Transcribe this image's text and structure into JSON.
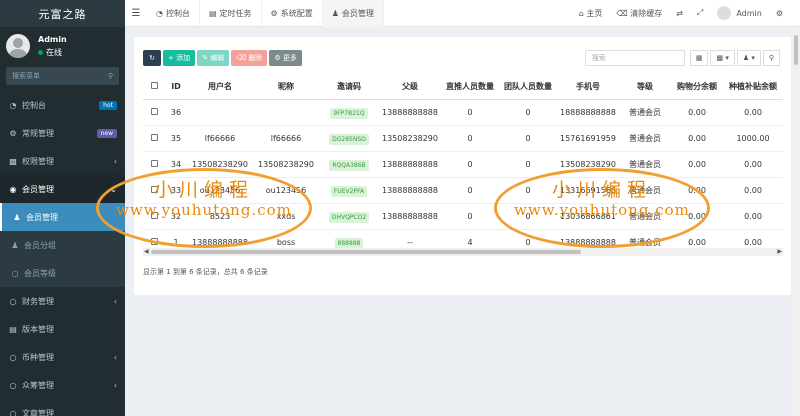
{
  "sidebar": {
    "logo": "元富之路",
    "user_name": "Admin",
    "user_status": "在线",
    "search_placeholder": "搜索菜单",
    "items": [
      {
        "label": "控制台",
        "icon": "dashboard-icon",
        "badge": "hot"
      },
      {
        "label": "常规管理",
        "icon": "cogs-icon",
        "badge": "new"
      },
      {
        "label": "权限管理",
        "icon": "group-icon",
        "arrow": "‹"
      },
      {
        "label": "会员管理",
        "icon": "user-circle-icon",
        "arrow": "⌄"
      },
      {
        "label": "会员管理",
        "icon": "user-icon"
      },
      {
        "label": "会员分组",
        "icon": "users-icon"
      },
      {
        "label": "会员等级",
        "icon": "circle-icon"
      },
      {
        "label": "财务管理",
        "icon": "circle-icon",
        "arrow": "‹"
      },
      {
        "label": "版本管理",
        "icon": "list-icon"
      },
      {
        "label": "币种管理",
        "icon": "circle-icon",
        "arrow": "‹"
      },
      {
        "label": "众筹管理",
        "icon": "circle-icon",
        "arrow": "‹"
      },
      {
        "label": "文章管理",
        "icon": "circle-icon"
      }
    ]
  },
  "topbar": {
    "tabs": [
      "控制台",
      "定时任务",
      "系统配置",
      "会员管理"
    ],
    "home": "主页",
    "clear_cache": "清除缓存",
    "user": "Admin"
  },
  "toolbar": {
    "add": "添加",
    "edit": "编辑",
    "delete": "删除",
    "more": "更多",
    "search_placeholder": "搜索"
  },
  "table": {
    "headers": [
      "",
      "ID",
      "用户名",
      "昵称",
      "邀请码",
      "父级",
      "直推人员数量",
      "团队人员数量",
      "手机号",
      "等级",
      "购物分余额",
      "种植补贴余额"
    ],
    "rows": [
      [
        "",
        "36",
        "",
        "",
        "9FP7B21Q",
        "13888888888",
        "0",
        "0",
        "18888888888",
        "普通会员",
        "0.00",
        "0.00"
      ],
      [
        "",
        "35",
        "lf66666",
        "lf66666",
        "DG285NSO",
        "13508238290",
        "0",
        "0",
        "15761691959",
        "普通会员",
        "0.00",
        "1000.00"
      ],
      [
        "",
        "34",
        "13508238290",
        "13508238290",
        "RQQA386B",
        "13888888888",
        "0",
        "0",
        "13508238290",
        "普通会员",
        "0.00",
        "0.00"
      ],
      [
        "",
        "33",
        "ou123456",
        "ou123456",
        "FUEV2PFA",
        "13888888888",
        "0",
        "0",
        "13316691566",
        "普通会员",
        "0.00",
        "0.00"
      ],
      [
        "",
        "32",
        "8523",
        "xxds",
        "DHVQPCO2",
        "13888888888",
        "0",
        "0",
        "13036866861",
        "普通会员",
        "0.00",
        "0.00"
      ],
      [
        "",
        "1",
        "13888888888",
        "boss",
        "888888",
        "--",
        "4",
        "0",
        "13888888888",
        "普通会员",
        "0.00",
        "0.00"
      ]
    ]
  },
  "footer": "显示第 1 到第 6 条记录，总共 6 条记录",
  "watermark": {
    "title": "小川编程",
    "url": "www.youhutong.com"
  }
}
